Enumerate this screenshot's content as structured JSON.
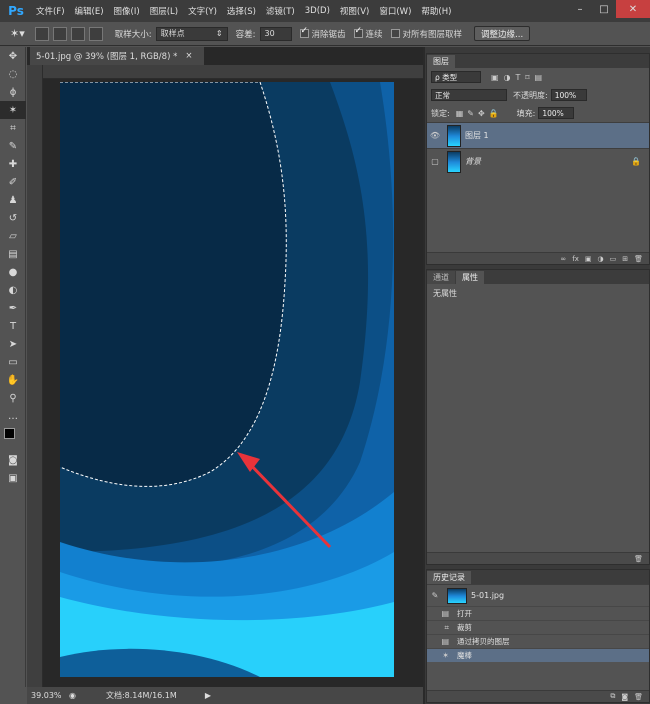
{
  "app": {
    "logo": "Ps"
  },
  "menu": [
    "文件(F)",
    "编辑(E)",
    "图像(I)",
    "图层(L)",
    "文字(Y)",
    "选择(S)",
    "滤镜(T)",
    "3D(D)",
    "视图(V)",
    "窗口(W)",
    "帮助(H)"
  ],
  "window_controls": {
    "minimize": "–",
    "maximize": "□",
    "close": "✕"
  },
  "options": {
    "sample_size_label": "取样大小:",
    "sample_size_value": "取样点",
    "tolerance_label": "容差:",
    "tolerance_value": "30",
    "antialias_label": "消除锯齿",
    "contiguous_label": "连续",
    "sample_all_label": "对所有图层取样",
    "refine_edge_button": "调整边缘..."
  },
  "document": {
    "tab_title": "5-01.jpg @ 39% (图层 1, RGB/8) *",
    "tab_close": "×"
  },
  "status": {
    "zoom": "39.03%",
    "doc_info": "文档:8.14M/16.1M"
  },
  "layers_panel": {
    "tab": "图层",
    "filter_label": "ρ 类型",
    "blend_mode": "正常",
    "opacity_label": "不透明度:",
    "opacity_value": "100%",
    "lock_label": "锁定:",
    "fill_label": "填充:",
    "fill_value": "100%",
    "layers": [
      {
        "name": "图层 1",
        "selected": true,
        "visible": true
      },
      {
        "name": "背景",
        "selected": false,
        "visible": false,
        "locked": true
      }
    ]
  },
  "properties_panel": {
    "tabs": [
      "通道",
      "属性"
    ],
    "content": "无属性"
  },
  "history_panel": {
    "tab": "历史记录",
    "snapshot": "5-01.jpg",
    "items": [
      "打开",
      "裁剪",
      "通过拷贝的图层",
      "魔棒"
    ]
  },
  "colors": {
    "canvas_top": "#0b2f4e",
    "canvas_mid": "#1576c4",
    "canvas_light": "#28d4ff",
    "arrow": "#e8333a",
    "selection_highlight": "#5c6f87"
  }
}
